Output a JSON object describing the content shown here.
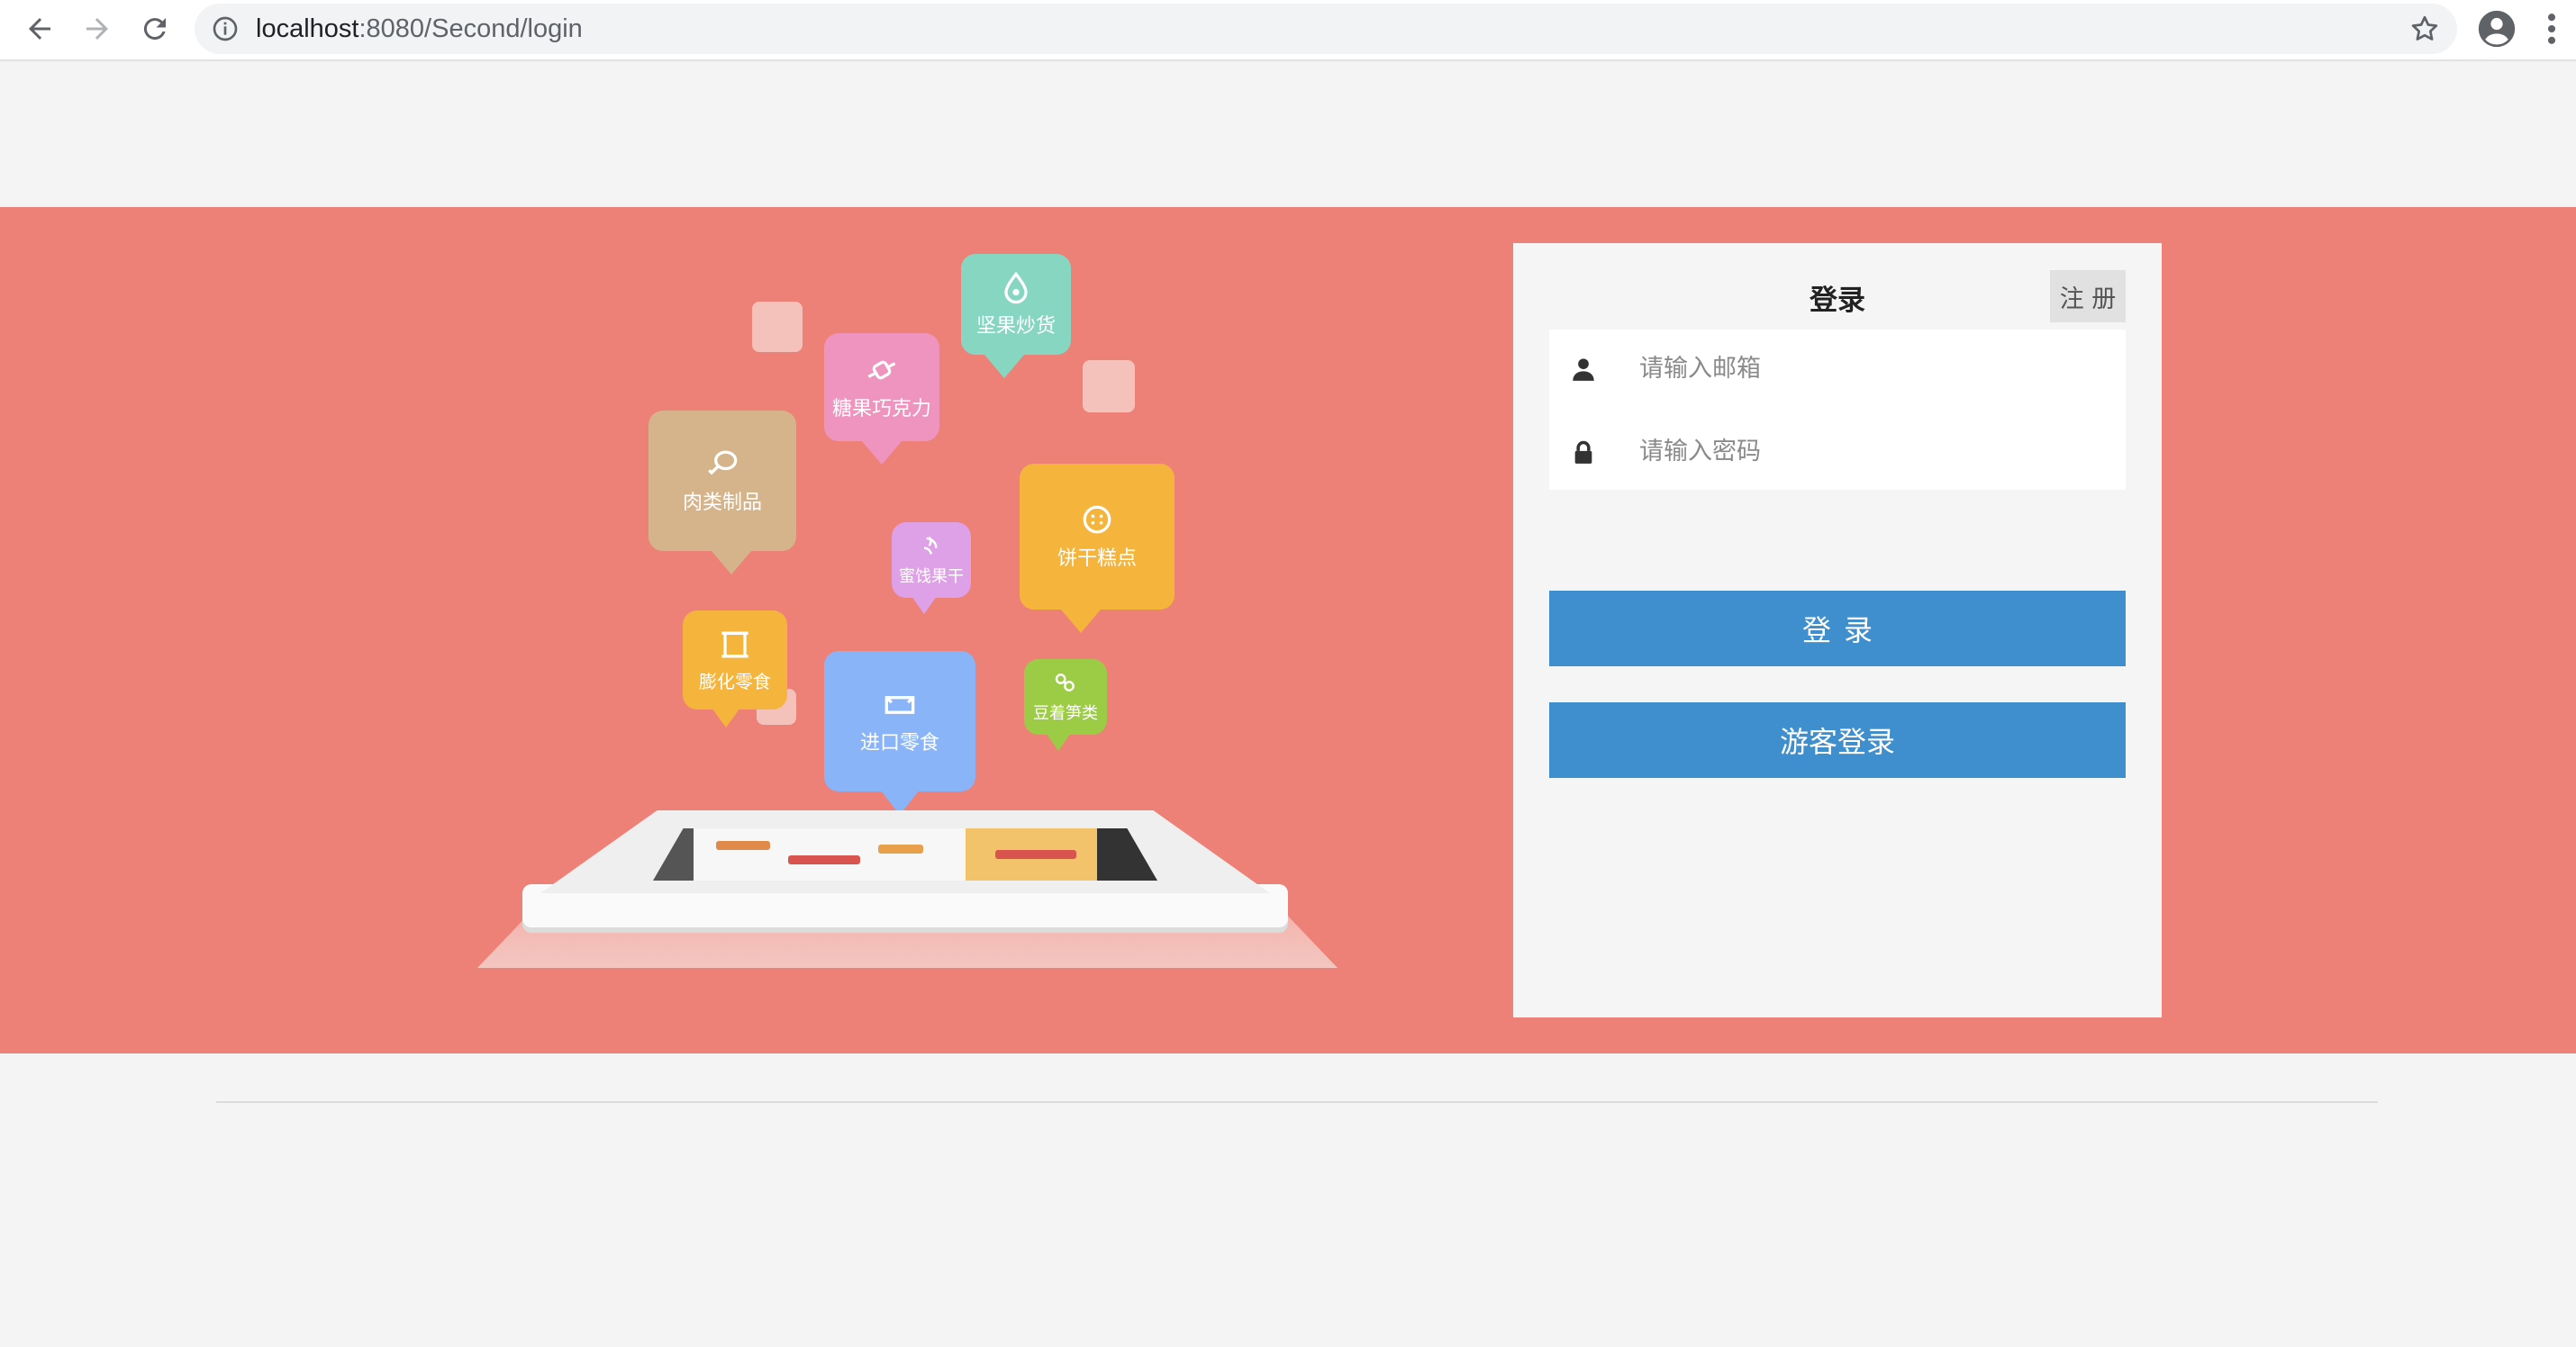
{
  "browser": {
    "url_host": "localhost",
    "url_rest": ":8080/Second/login",
    "icons": [
      "back-arrow-icon",
      "forward-arrow-icon",
      "reload-icon",
      "info-icon",
      "star-icon",
      "profile-icon",
      "more-vert-icon"
    ]
  },
  "banner": {
    "color": "#ed8178",
    "categories": [
      {
        "label": "坚果炒货",
        "color": "#86d6c1",
        "icon": "nut-icon"
      },
      {
        "label": "糖果巧克力",
        "color": "#ee94bf",
        "icon": "candy-icon"
      },
      {
        "label": "肉类制品",
        "color": "#d5b48c",
        "icon": "meat-icon"
      },
      {
        "label": "饼干糕点",
        "color": "#f5b43c",
        "icon": "cookie-icon"
      },
      {
        "label": "蜜饯果干",
        "color": "#dea0e6",
        "icon": "dried-fruit-icon"
      },
      {
        "label": "膨化零食",
        "color": "#f5b43c",
        "icon": "snack-bag-icon"
      },
      {
        "label": "进口零食",
        "color": "#8ab4f8",
        "icon": "import-icon"
      },
      {
        "label": "豆着笋类",
        "color": "#9ccc45",
        "icon": "bean-icon"
      }
    ]
  },
  "login": {
    "title": "登录",
    "register_label": "注 册",
    "email_placeholder": "请输入邮箱",
    "password_placeholder": "请输入密码",
    "login_label": "登录",
    "guest_label": "游客登录",
    "button_color": "#3f8ecd"
  }
}
